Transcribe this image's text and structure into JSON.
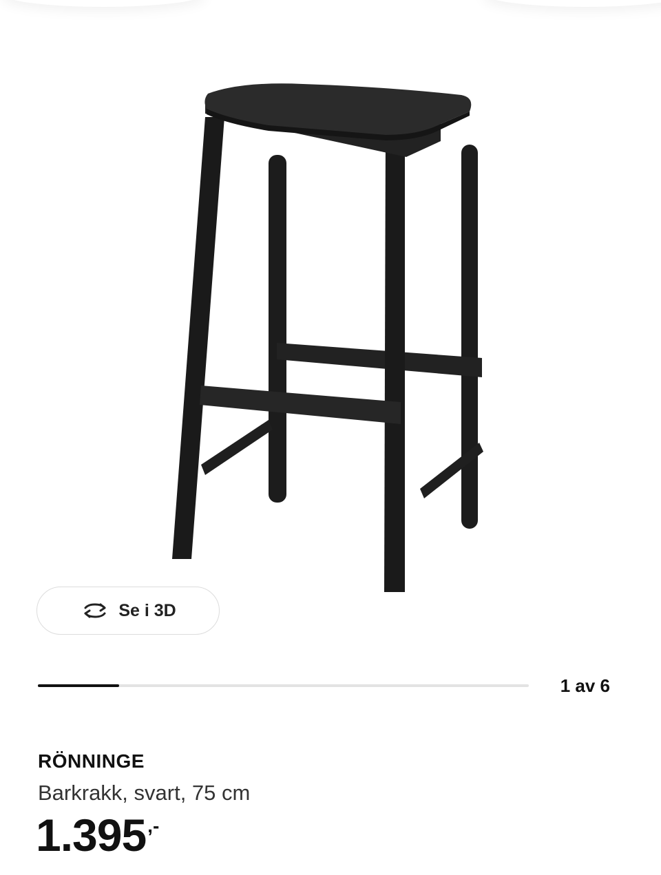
{
  "product": {
    "image_alt": "RÖNNINGE barkrakk",
    "name": "RÖNNINGE",
    "description": "Barkrakk, svart, 75 cm",
    "price_amount": "1.395",
    "price_suffix": ",-"
  },
  "view_3d": {
    "label": "Se i 3D",
    "icon": "rotate-3d-icon"
  },
  "carousel": {
    "counter": "1 av 6",
    "current": 1,
    "total": 6,
    "progress_fraction": 0.165
  },
  "colors": {
    "stool": "#1c1c1c",
    "stool_highlight": "#2e2e2e",
    "track": "#e3e3e3",
    "fill": "#111111"
  }
}
